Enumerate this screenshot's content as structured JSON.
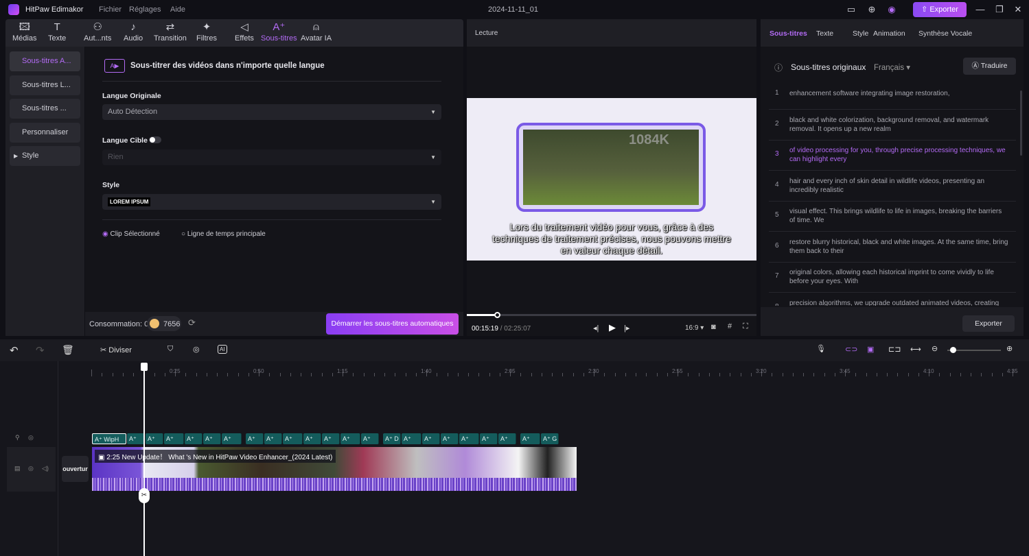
{
  "app": {
    "name": "HitPaw Edimakor",
    "menus": [
      "Fichier",
      "Réglages",
      "Aide"
    ],
    "project_title": "2024-11-11_01",
    "export_label": "Exporter",
    "accent": "#b36bf5"
  },
  "toolbar": [
    {
      "label": "Médias",
      "icon": "media-icon",
      "glyph": "🖾"
    },
    {
      "label": "Texte",
      "icon": "text-icon",
      "glyph": "T"
    },
    {
      "label": "Aut...nts",
      "icon": "elements-icon",
      "glyph": "⚇"
    },
    {
      "label": "Audio",
      "icon": "music-note-icon",
      "glyph": "♪"
    },
    {
      "label": "Transition",
      "icon": "transition-icon",
      "glyph": "⇄"
    },
    {
      "label": "Filtres",
      "icon": "sparkle-icon",
      "glyph": "✦"
    },
    {
      "label": "Effets",
      "icon": "effects-icon",
      "glyph": "◁"
    },
    {
      "label": "Sous-titres",
      "icon": "subtitles-icon",
      "glyph": "A⁺",
      "active": true
    },
    {
      "label": "Avatar IA",
      "icon": "avatar-icon",
      "glyph": "⍝"
    }
  ],
  "sidebar": [
    {
      "label": "Sous-titres A...",
      "active": true
    },
    {
      "label": "Sous-titres L..."
    },
    {
      "label": "Sous-titres ..."
    },
    {
      "label": "Personnaliser"
    },
    {
      "label": "Style",
      "expandable": true
    }
  ],
  "subtitle_panel": {
    "heading": "Sous-titrer des vidéos dans n'importe quelle langue",
    "orig_label": "Langue Originale",
    "orig_value": "Auto Détection",
    "target_label": "Langue Cible",
    "target_enabled": false,
    "target_value": "Rien",
    "style_label": "Style",
    "style_value": "LOREM IPSUM",
    "radio_options": [
      {
        "label": "Clip Sélectionné",
        "selected": true
      },
      {
        "label": "Ligne de temps principale",
        "selected": false
      }
    ],
    "consumption": "Consommation: 0",
    "credits": "7656",
    "start_button": "Démarrer les sous-titres automatiques"
  },
  "preview": {
    "title": "Lecture",
    "video_badge": "1084K",
    "caption": "Lors du traitement vidéo pour vous, grâce à des techniques de traitement précises, nous pouvons mettre en valeur chaque détail.",
    "current_time": "00:15:19",
    "total_time": "/ 02:25:07",
    "progress_percent": 10.5,
    "aspect": "16:9"
  },
  "right_panel": {
    "tabs": [
      "Sous-titres",
      "Texte",
      "Style",
      "Animation",
      "Synthèse Vocale"
    ],
    "active_tab": "Sous-titres",
    "heading": "Sous-titres originaux",
    "language": "Français",
    "translate_label": "Traduire",
    "export_label": "Exporter",
    "rows": [
      {
        "n": "1",
        "text": "enhancement software integrating image restoration,"
      },
      {
        "n": "2",
        "text": "black and white colorization, background removal, and watermark removal. It opens up a new realm"
      },
      {
        "n": "3",
        "text": "of video processing for you, through precise processing techniques, we can highlight every",
        "active": true
      },
      {
        "n": "4",
        "text": "hair and every inch of skin detail in wildlife videos, presenting an incredibly realistic"
      },
      {
        "n": "5",
        "text": "visual effect. This brings wildlife to life in images, breaking the barriers of time. We"
      },
      {
        "n": "6",
        "text": "restore blurry historical, black and white images. At the same time, bring them back to their"
      },
      {
        "n": "7",
        "text": "original colors, allowing each historical imprint to come vividly to life before your eyes. With"
      },
      {
        "n": "8",
        "text": "precision algorithms, we upgrade outdated animated videos, creating smoother and more refined images."
      }
    ]
  },
  "timeline": {
    "split_label": "Diviser",
    "ruler": [
      "0:25",
      "0:50",
      "1:15",
      "1:40",
      "2:05",
      "2:30",
      "2:55",
      "3:20",
      "3:45",
      "4:10",
      "4:35"
    ],
    "zoom_percent": 10,
    "subtitle_clips": [
      "A⁺ WipH",
      "A⁺",
      "A⁺",
      "A⁺",
      "A⁺",
      "A⁺",
      "A⁺",
      "A⁺",
      "A⁺",
      "A⁺",
      "A⁺",
      "A⁺",
      "A⁺",
      "A⁺",
      "A⁺ D",
      "A⁺",
      "A⁺",
      "A⁺",
      "A⁺",
      "A⁺",
      "A⁺",
      "A⁺",
      "A⁺ G"
    ],
    "video_clip_title": "2:25 New Update！ What  's New in HitPaw Video Enhancer_(2024 Latest)",
    "intro_clip": "ouvertur"
  }
}
